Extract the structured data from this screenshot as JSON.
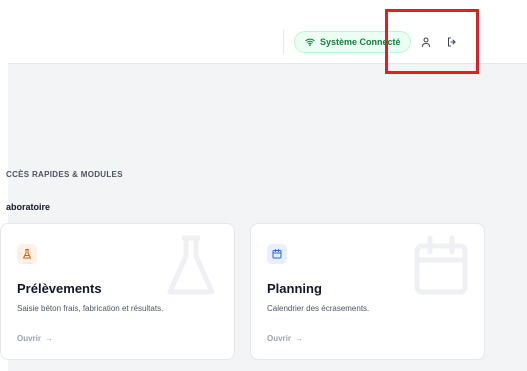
{
  "header": {
    "status_label": "Système Connecté",
    "status_color": "#15803d",
    "icons": [
      "wifi-icon",
      "user-icon",
      "logout-icon"
    ],
    "highlight_color": "#e11d2a"
  },
  "section": {
    "title": "CCÈS RAPIDES & MODULES",
    "group_title": "aboratoire"
  },
  "cards": [
    {
      "title": "Prélèvements",
      "description": "Saisie béton frais, fabrication et résultats.",
      "link_label": "Ouvrir",
      "link_arrow": "→",
      "icon": "flask-icon",
      "accent": "#ea580c"
    },
    {
      "title": "Planning",
      "description": "Calendrier des écrasements.",
      "link_label": "Ouvrir",
      "link_arrow": "→",
      "icon": "calendar-icon",
      "accent": "#2563eb"
    }
  ]
}
